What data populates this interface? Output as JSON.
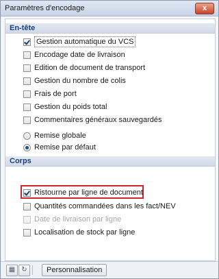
{
  "window": {
    "title": "Paramètres d'encodage",
    "close_label": "x"
  },
  "sections": {
    "entete": {
      "header": "En-tête",
      "checkboxes": [
        {
          "label": "Gestion automatique du VCS",
          "checked": true
        },
        {
          "label": "Encodage date de livraison",
          "checked": false
        },
        {
          "label": "Edition de document de transport",
          "checked": false
        },
        {
          "label": "Gestion du nombre de colis",
          "checked": false
        },
        {
          "label": "Frais de port",
          "checked": false
        },
        {
          "label": "Gestion du poids total",
          "checked": false
        },
        {
          "label": "Commentaires généraux sauvegardés",
          "checked": false
        }
      ],
      "radios": [
        {
          "label": "Remise globale",
          "checked": false
        },
        {
          "label": "Remise par défaut",
          "checked": true
        }
      ]
    },
    "corps": {
      "header": "Corps",
      "checkboxes": [
        {
          "label": "Ristourne par ligne de document",
          "checked": true
        },
        {
          "label": "Quantités commandées dans les fact/NEV",
          "checked": false
        },
        {
          "label": "Date de livraison par ligne",
          "checked": false,
          "disabled": true
        },
        {
          "label": "Localisation de stock par ligne",
          "checked": false
        }
      ]
    }
  },
  "bottombar": {
    "icons": [
      "layout-icon",
      "refresh-icon"
    ],
    "personalisation_label": "Personnalisation"
  },
  "colors": {
    "highlight": "#c8282c",
    "header_text": "#1a3f7a"
  }
}
